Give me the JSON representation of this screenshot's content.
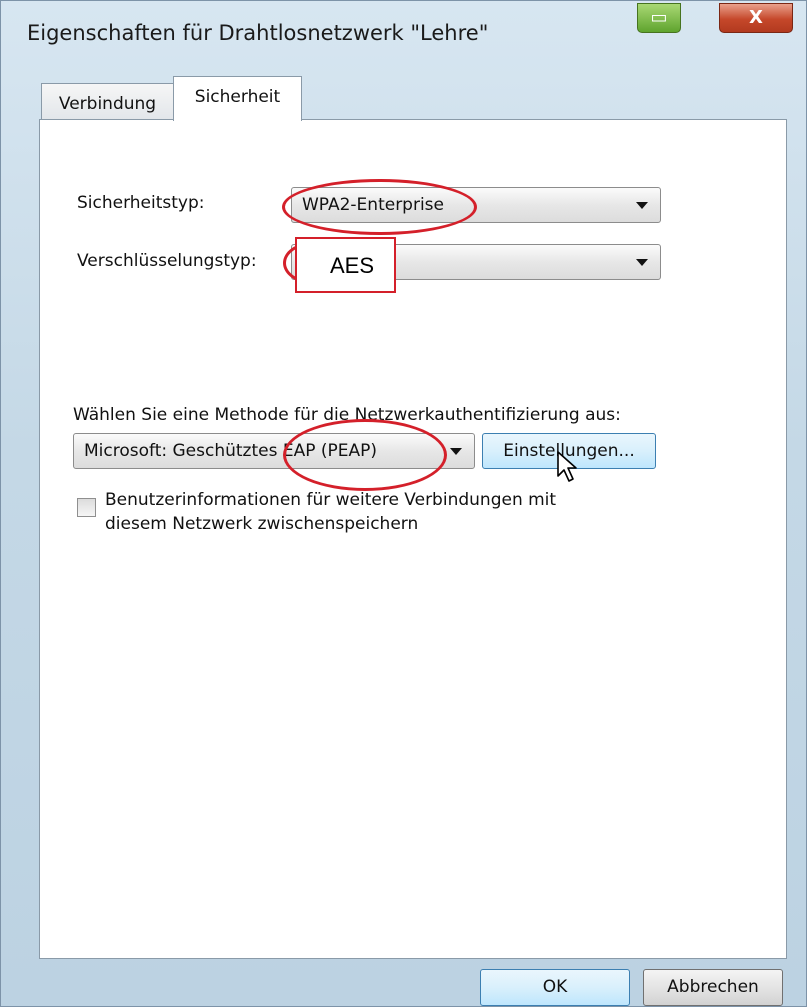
{
  "window": {
    "title": "Eigenschaften für Drahtlosnetzwerk \"Lehre\""
  },
  "titlebar_buttons": {
    "minimize_icon": "minimize-icon",
    "close_icon": "close-icon",
    "close_glyph": "X"
  },
  "tabs": [
    {
      "label": "Verbindung",
      "active": false
    },
    {
      "label": "Sicherheit",
      "active": true
    }
  ],
  "security": {
    "type_label": "Sicherheitstyp:",
    "type_value": "WPA2-Enterprise",
    "encryption_label": "Verschlüsselungstyp:",
    "encryption_value": "AES",
    "method_label": "Wählen Sie eine Methode für die Netzwerkauthentifizierung aus:",
    "method_value": "Microsoft: Geschütztes EAP (PEAP)",
    "settings_button": "Einstellungen...",
    "remember_checkbox_line1": "Benutzerinformationen für weitere Verbindungen mit",
    "remember_checkbox_line2": "diesem Netzwerk zwischenspeichern",
    "remember_checked": false
  },
  "footer": {
    "ok": "OK",
    "cancel": "Abbrechen"
  },
  "annotation_color": "#d4202a"
}
